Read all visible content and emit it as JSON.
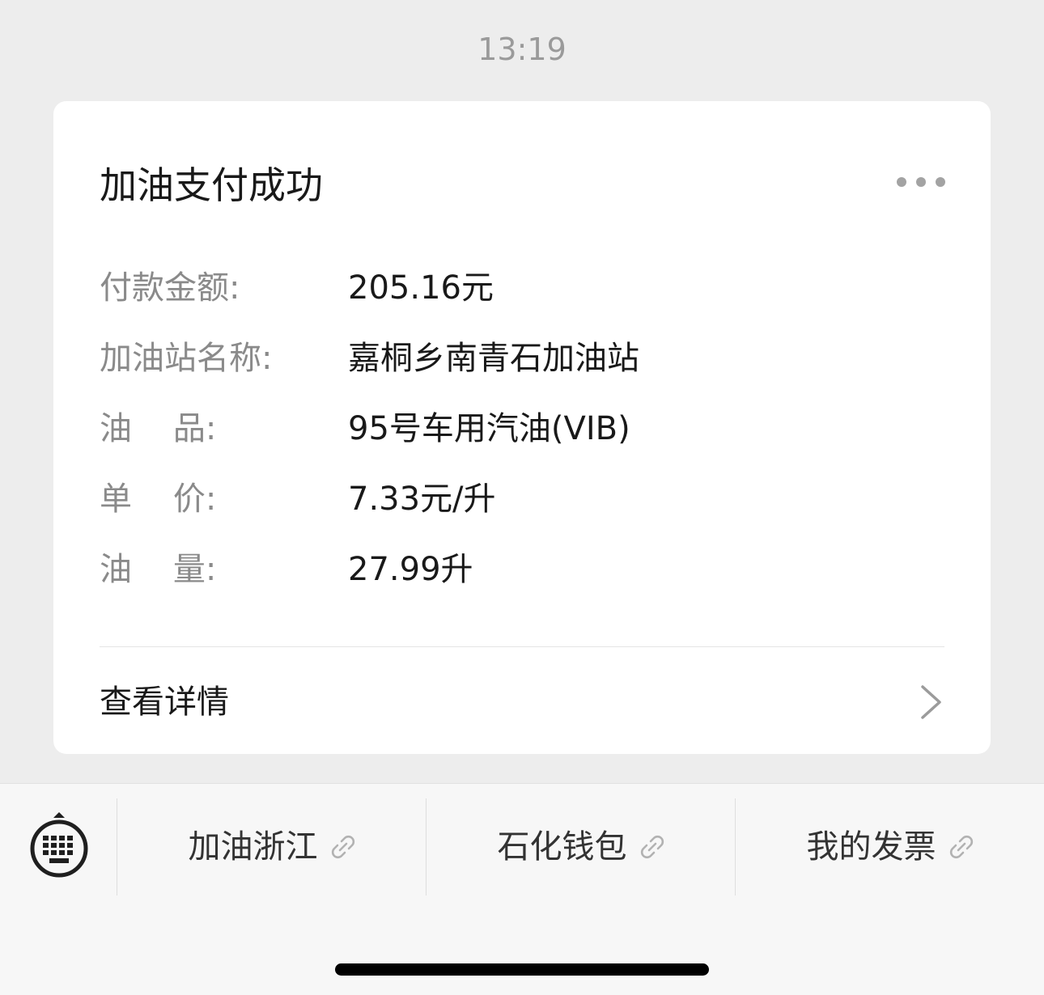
{
  "status": {
    "time": "13:19"
  },
  "card": {
    "title": "加油支付成功",
    "rows": [
      {
        "label": "付款金额:",
        "value": "205.16元"
      },
      {
        "label": "加油站名称:",
        "value": "嘉桐乡南青石加油站"
      },
      {
        "label": "油    品:",
        "value": "95号车用汽油(VIB)"
      },
      {
        "label": "单    价:",
        "value": "7.33元/升"
      },
      {
        "label": "油    量:",
        "value": "27.99升"
      }
    ],
    "detail_label": "查看详情"
  },
  "menu": {
    "items": [
      {
        "label": "加油浙江"
      },
      {
        "label": "石化钱包"
      },
      {
        "label": "我的发票"
      }
    ]
  }
}
